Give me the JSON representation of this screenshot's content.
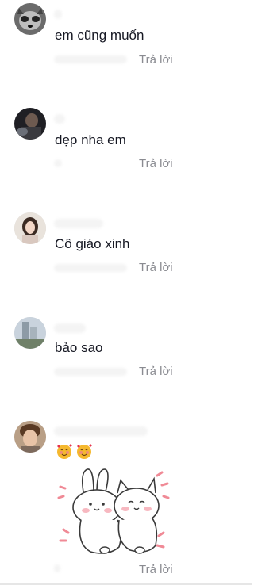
{
  "comments": [
    {
      "text": "em cũng muốn",
      "reply_label": "Trả lời"
    },
    {
      "text": "dẹp nha em",
      "reply_label": "Trả lời"
    },
    {
      "text": "Cô giáo xinh",
      "reply_label": "Trả lời"
    },
    {
      "text": "bảo sao",
      "reply_label": "Trả lời"
    },
    {
      "text": "",
      "reply_label": "Trả lời"
    }
  ]
}
